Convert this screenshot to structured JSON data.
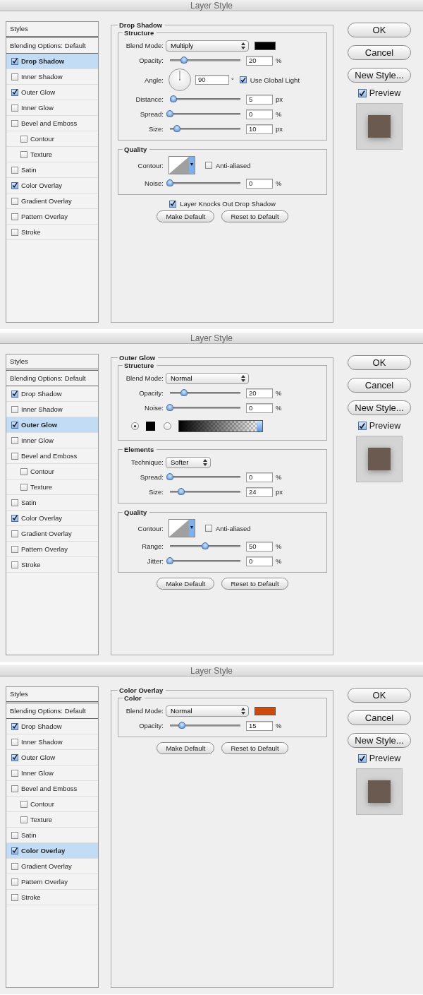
{
  "dialogs": [
    {
      "title": "Layer Style",
      "styles_header": "Styles",
      "blending_options": "Blending Options: Default",
      "styles": [
        {
          "label": "Drop Shadow",
          "checked": true,
          "selected": true
        },
        {
          "label": "Inner Shadow",
          "checked": false,
          "selected": false
        },
        {
          "label": "Outer Glow",
          "checked": true,
          "selected": false
        },
        {
          "label": "Inner Glow",
          "checked": false,
          "selected": false
        },
        {
          "label": "Bevel and Emboss",
          "checked": false,
          "selected": false,
          "children": [
            {
              "label": "Contour",
              "checked": false,
              "selected": false
            },
            {
              "label": "Texture",
              "checked": false,
              "selected": false
            }
          ]
        },
        {
          "label": "Satin",
          "checked": false,
          "selected": false
        },
        {
          "label": "Color Overlay",
          "checked": true,
          "selected": false
        },
        {
          "label": "Gradient Overlay",
          "checked": false,
          "selected": false
        },
        {
          "label": "Pattern Overlay",
          "checked": false,
          "selected": false
        },
        {
          "label": "Stroke",
          "checked": false,
          "selected": false
        }
      ],
      "panel": {
        "title": "Drop Shadow",
        "groups": [
          {
            "title": "Structure",
            "rows": [
              {
                "kind": "select",
                "label": "Blend Mode:",
                "value": "Multiply",
                "color": "#000000"
              },
              {
                "kind": "slider",
                "label": "Opacity:",
                "level": 0.2,
                "value": "20",
                "unit": "%"
              },
              {
                "kind": "angle",
                "label": "Angle:",
                "value": "90",
                "unit": "°",
                "checkbox": {
                  "label": "Use Global Light",
                  "checked": true
                }
              },
              {
                "kind": "slider",
                "label": "Distance:",
                "level": 0.05,
                "value": "5",
                "unit": "px"
              },
              {
                "kind": "slider",
                "label": "Spread:",
                "level": 0,
                "value": "0",
                "unit": "%"
              },
              {
                "kind": "slider",
                "label": "Size:",
                "level": 0.1,
                "value": "10",
                "unit": "px"
              }
            ]
          },
          {
            "title": "Quality",
            "rows": [
              {
                "kind": "contour",
                "label": "Contour:",
                "checkbox": {
                  "label": "Anti-aliased",
                  "checked": false
                }
              },
              {
                "kind": "slider",
                "label": "Noise:",
                "level": 0,
                "value": "0",
                "unit": "%"
              }
            ]
          }
        ],
        "knockout": {
          "label": "Layer Knocks Out Drop Shadow",
          "checked": true
        },
        "buttons": [
          "Make Default",
          "Reset to Default"
        ]
      },
      "buttons": [
        "OK",
        "Cancel",
        "New Style..."
      ],
      "preview": {
        "label": "Preview",
        "checked": true
      }
    },
    {
      "title": "Layer Style",
      "styles_header": "Styles",
      "blending_options": "Blending Options: Default",
      "styles": [
        {
          "label": "Drop Shadow",
          "checked": true,
          "selected": false
        },
        {
          "label": "Inner Shadow",
          "checked": false,
          "selected": false
        },
        {
          "label": "Outer Glow",
          "checked": true,
          "selected": true
        },
        {
          "label": "Inner Glow",
          "checked": false,
          "selected": false
        },
        {
          "label": "Bevel and Emboss",
          "checked": false,
          "selected": false,
          "children": [
            {
              "label": "Contour",
              "checked": false,
              "selected": false
            },
            {
              "label": "Texture",
              "checked": false,
              "selected": false
            }
          ]
        },
        {
          "label": "Satin",
          "checked": false,
          "selected": false
        },
        {
          "label": "Color Overlay",
          "checked": true,
          "selected": false
        },
        {
          "label": "Gradient Overlay",
          "checked": false,
          "selected": false
        },
        {
          "label": "Pattern Overlay",
          "checked": false,
          "selected": false
        },
        {
          "label": "Stroke",
          "checked": false,
          "selected": false
        }
      ],
      "panel": {
        "title": "Outer Glow",
        "groups": [
          {
            "title": "Structure",
            "rows": [
              {
                "kind": "select",
                "label": "Blend Mode:",
                "value": "Normal"
              },
              {
                "kind": "slider",
                "label": "Opacity:",
                "level": 0.2,
                "value": "20",
                "unit": "%"
              },
              {
                "kind": "slider",
                "label": "Noise:",
                "level": 0,
                "value": "0",
                "unit": "%"
              },
              {
                "kind": "source",
                "options": [
                  {
                    "kind": "color",
                    "selected": true,
                    "color": "#000000"
                  },
                  {
                    "kind": "gradient",
                    "selected": false
                  }
                ]
              }
            ]
          },
          {
            "title": "Elements",
            "rows": [
              {
                "kind": "picker",
                "label": "Technique:",
                "value": "Softer"
              },
              {
                "kind": "slider",
                "label": "Spread:",
                "level": 0,
                "value": "0",
                "unit": "%"
              },
              {
                "kind": "slider",
                "label": "Size:",
                "level": 0.16,
                "value": "24",
                "unit": "px"
              }
            ]
          },
          {
            "title": "Quality",
            "rows": [
              {
                "kind": "contour",
                "label": "Contour:",
                "checkbox": {
                  "label": "Anti-aliased",
                  "checked": false
                }
              },
              {
                "kind": "slider",
                "label": "Range:",
                "level": 0.5,
                "value": "50",
                "unit": "%"
              },
              {
                "kind": "slider",
                "label": "Jitter:",
                "level": 0,
                "value": "0",
                "unit": "%"
              }
            ]
          }
        ],
        "buttons": [
          "Make Default",
          "Reset to Default"
        ]
      },
      "buttons": [
        "OK",
        "Cancel",
        "New Style..."
      ],
      "preview": {
        "label": "Preview",
        "checked": true
      }
    },
    {
      "title": "Layer Style",
      "styles_header": "Styles",
      "blending_options": "Blending Options: Default",
      "styles": [
        {
          "label": "Drop Shadow",
          "checked": true,
          "selected": false
        },
        {
          "label": "Inner Shadow",
          "checked": false,
          "selected": false
        },
        {
          "label": "Outer Glow",
          "checked": true,
          "selected": false
        },
        {
          "label": "Inner Glow",
          "checked": false,
          "selected": false
        },
        {
          "label": "Bevel and Emboss",
          "checked": false,
          "selected": false,
          "children": [
            {
              "label": "Contour",
              "checked": false,
              "selected": false
            },
            {
              "label": "Texture",
              "checked": false,
              "selected": false
            }
          ]
        },
        {
          "label": "Satin",
          "checked": false,
          "selected": false
        },
        {
          "label": "Color Overlay",
          "checked": true,
          "selected": true
        },
        {
          "label": "Gradient Overlay",
          "checked": false,
          "selected": false
        },
        {
          "label": "Pattern Overlay",
          "checked": false,
          "selected": false
        },
        {
          "label": "Stroke",
          "checked": false,
          "selected": false
        }
      ],
      "panel": {
        "title": "Color Overlay",
        "groups": [
          {
            "title": "Color",
            "rows": [
              {
                "kind": "select",
                "label": "Blend Mode:",
                "value": "Normal",
                "color": "#cc4a0a"
              },
              {
                "kind": "slider",
                "label": "Opacity:",
                "level": 0.17,
                "value": "15",
                "unit": "%"
              }
            ]
          }
        ],
        "buttons": [
          "Make Default",
          "Reset to Default"
        ]
      },
      "buttons": [
        "OK",
        "Cancel",
        "New Style..."
      ],
      "preview": {
        "label": "Preview",
        "checked": true
      }
    }
  ]
}
